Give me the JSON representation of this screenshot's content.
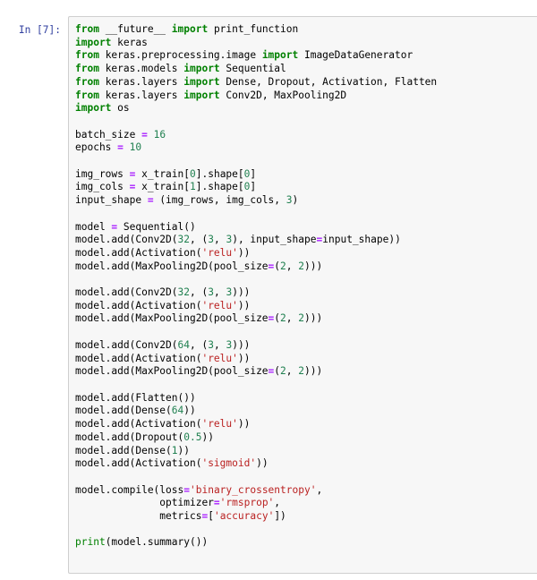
{
  "notebook": {
    "prompt_label": "In [7]:",
    "cell_type": "code",
    "language": "python",
    "colors": {
      "prompt": "#303F9F",
      "cell_background": "#f7f7f7",
      "cell_border": "#cfcfcf",
      "keyword": "#008000",
      "number": "#208050",
      "string": "#BA2121",
      "operator": "#AA22FF",
      "builtin": "#008000",
      "plain": "#000000",
      "page_background": "#ffffff"
    },
    "code_lines": [
      [
        {
          "t": "from",
          "c": "k"
        },
        {
          "t": " __future__ ",
          "c": "p"
        },
        {
          "t": "import",
          "c": "k"
        },
        {
          "t": " print_function",
          "c": "p"
        }
      ],
      [
        {
          "t": "import",
          "c": "k"
        },
        {
          "t": " keras",
          "c": "p"
        }
      ],
      [
        {
          "t": "from",
          "c": "k"
        },
        {
          "t": " keras.preprocessing.image ",
          "c": "p"
        },
        {
          "t": "import",
          "c": "k"
        },
        {
          "t": " ImageDataGenerator",
          "c": "p"
        }
      ],
      [
        {
          "t": "from",
          "c": "k"
        },
        {
          "t": " keras.models ",
          "c": "p"
        },
        {
          "t": "import",
          "c": "k"
        },
        {
          "t": " Sequential",
          "c": "p"
        }
      ],
      [
        {
          "t": "from",
          "c": "k"
        },
        {
          "t": " keras.layers ",
          "c": "p"
        },
        {
          "t": "import",
          "c": "k"
        },
        {
          "t": " Dense, Dropout, Activation, Flatten",
          "c": "p"
        }
      ],
      [
        {
          "t": "from",
          "c": "k"
        },
        {
          "t": " keras.layers ",
          "c": "p"
        },
        {
          "t": "import",
          "c": "k"
        },
        {
          "t": " Conv2D, MaxPooling2D",
          "c": "p"
        }
      ],
      [
        {
          "t": "import",
          "c": "k"
        },
        {
          "t": " os",
          "c": "p"
        }
      ],
      [],
      [
        {
          "t": "batch_size ",
          "c": "p"
        },
        {
          "t": "=",
          "c": "o"
        },
        {
          "t": " ",
          "c": "p"
        },
        {
          "t": "16",
          "c": "n"
        }
      ],
      [
        {
          "t": "epochs ",
          "c": "p"
        },
        {
          "t": "=",
          "c": "o"
        },
        {
          "t": " ",
          "c": "p"
        },
        {
          "t": "10",
          "c": "n"
        }
      ],
      [],
      [
        {
          "t": "img_rows ",
          "c": "p"
        },
        {
          "t": "=",
          "c": "o"
        },
        {
          "t": " x_train[",
          "c": "p"
        },
        {
          "t": "0",
          "c": "n"
        },
        {
          "t": "].shape[",
          "c": "p"
        },
        {
          "t": "0",
          "c": "n"
        },
        {
          "t": "]",
          "c": "p"
        }
      ],
      [
        {
          "t": "img_cols ",
          "c": "p"
        },
        {
          "t": "=",
          "c": "o"
        },
        {
          "t": " x_train[",
          "c": "p"
        },
        {
          "t": "1",
          "c": "n"
        },
        {
          "t": "].shape[",
          "c": "p"
        },
        {
          "t": "0",
          "c": "n"
        },
        {
          "t": "]",
          "c": "p"
        }
      ],
      [
        {
          "t": "input_shape ",
          "c": "p"
        },
        {
          "t": "=",
          "c": "o"
        },
        {
          "t": " (img_rows, img_cols, ",
          "c": "p"
        },
        {
          "t": "3",
          "c": "n"
        },
        {
          "t": ")",
          "c": "p"
        }
      ],
      [],
      [
        {
          "t": "model ",
          "c": "p"
        },
        {
          "t": "=",
          "c": "o"
        },
        {
          "t": " Sequential()",
          "c": "p"
        }
      ],
      [
        {
          "t": "model.add(Conv2D(",
          "c": "p"
        },
        {
          "t": "32",
          "c": "n"
        },
        {
          "t": ", (",
          "c": "p"
        },
        {
          "t": "3",
          "c": "n"
        },
        {
          "t": ", ",
          "c": "p"
        },
        {
          "t": "3",
          "c": "n"
        },
        {
          "t": "), input_shape",
          "c": "p"
        },
        {
          "t": "=",
          "c": "o"
        },
        {
          "t": "input_shape))",
          "c": "p"
        }
      ],
      [
        {
          "t": "model.add(Activation(",
          "c": "p"
        },
        {
          "t": "'relu'",
          "c": "s"
        },
        {
          "t": "))",
          "c": "p"
        }
      ],
      [
        {
          "t": "model.add(MaxPooling2D(pool_size",
          "c": "p"
        },
        {
          "t": "=",
          "c": "o"
        },
        {
          "t": "(",
          "c": "p"
        },
        {
          "t": "2",
          "c": "n"
        },
        {
          "t": ", ",
          "c": "p"
        },
        {
          "t": "2",
          "c": "n"
        },
        {
          "t": ")))",
          "c": "p"
        }
      ],
      [],
      [
        {
          "t": "model.add(Conv2D(",
          "c": "p"
        },
        {
          "t": "32",
          "c": "n"
        },
        {
          "t": ", (",
          "c": "p"
        },
        {
          "t": "3",
          "c": "n"
        },
        {
          "t": ", ",
          "c": "p"
        },
        {
          "t": "3",
          "c": "n"
        },
        {
          "t": ")))",
          "c": "p"
        }
      ],
      [
        {
          "t": "model.add(Activation(",
          "c": "p"
        },
        {
          "t": "'relu'",
          "c": "s"
        },
        {
          "t": "))",
          "c": "p"
        }
      ],
      [
        {
          "t": "model.add(MaxPooling2D(pool_size",
          "c": "p"
        },
        {
          "t": "=",
          "c": "o"
        },
        {
          "t": "(",
          "c": "p"
        },
        {
          "t": "2",
          "c": "n"
        },
        {
          "t": ", ",
          "c": "p"
        },
        {
          "t": "2",
          "c": "n"
        },
        {
          "t": ")))",
          "c": "p"
        }
      ],
      [],
      [
        {
          "t": "model.add(Conv2D(",
          "c": "p"
        },
        {
          "t": "64",
          "c": "n"
        },
        {
          "t": ", (",
          "c": "p"
        },
        {
          "t": "3",
          "c": "n"
        },
        {
          "t": ", ",
          "c": "p"
        },
        {
          "t": "3",
          "c": "n"
        },
        {
          "t": ")))",
          "c": "p"
        }
      ],
      [
        {
          "t": "model.add(Activation(",
          "c": "p"
        },
        {
          "t": "'relu'",
          "c": "s"
        },
        {
          "t": "))",
          "c": "p"
        }
      ],
      [
        {
          "t": "model.add(MaxPooling2D(pool_size",
          "c": "p"
        },
        {
          "t": "=",
          "c": "o"
        },
        {
          "t": "(",
          "c": "p"
        },
        {
          "t": "2",
          "c": "n"
        },
        {
          "t": ", ",
          "c": "p"
        },
        {
          "t": "2",
          "c": "n"
        },
        {
          "t": ")))",
          "c": "p"
        }
      ],
      [],
      [
        {
          "t": "model.add(Flatten())",
          "c": "p"
        }
      ],
      [
        {
          "t": "model.add(Dense(",
          "c": "p"
        },
        {
          "t": "64",
          "c": "n"
        },
        {
          "t": "))",
          "c": "p"
        }
      ],
      [
        {
          "t": "model.add(Activation(",
          "c": "p"
        },
        {
          "t": "'relu'",
          "c": "s"
        },
        {
          "t": "))",
          "c": "p"
        }
      ],
      [
        {
          "t": "model.add(Dropout(",
          "c": "p"
        },
        {
          "t": "0.5",
          "c": "n"
        },
        {
          "t": "))",
          "c": "p"
        }
      ],
      [
        {
          "t": "model.add(Dense(",
          "c": "p"
        },
        {
          "t": "1",
          "c": "n"
        },
        {
          "t": "))",
          "c": "p"
        }
      ],
      [
        {
          "t": "model.add(Activation(",
          "c": "p"
        },
        {
          "t": "'sigmoid'",
          "c": "s"
        },
        {
          "t": "))",
          "c": "p"
        }
      ],
      [],
      [
        {
          "t": "model.compile(loss",
          "c": "p"
        },
        {
          "t": "=",
          "c": "o"
        },
        {
          "t": "'binary_crossentropy'",
          "c": "s"
        },
        {
          "t": ",",
          "c": "p"
        }
      ],
      [
        {
          "t": "              optimizer",
          "c": "p"
        },
        {
          "t": "=",
          "c": "o"
        },
        {
          "t": "'rmsprop'",
          "c": "s"
        },
        {
          "t": ",",
          "c": "p"
        }
      ],
      [
        {
          "t": "              metrics",
          "c": "p"
        },
        {
          "t": "=",
          "c": "o"
        },
        {
          "t": "[",
          "c": "p"
        },
        {
          "t": "'accuracy'",
          "c": "s"
        },
        {
          "t": "])",
          "c": "p"
        }
      ],
      [],
      [
        {
          "t": "print",
          "c": "b"
        },
        {
          "t": "(model.summary())",
          "c": "p"
        }
      ]
    ]
  }
}
